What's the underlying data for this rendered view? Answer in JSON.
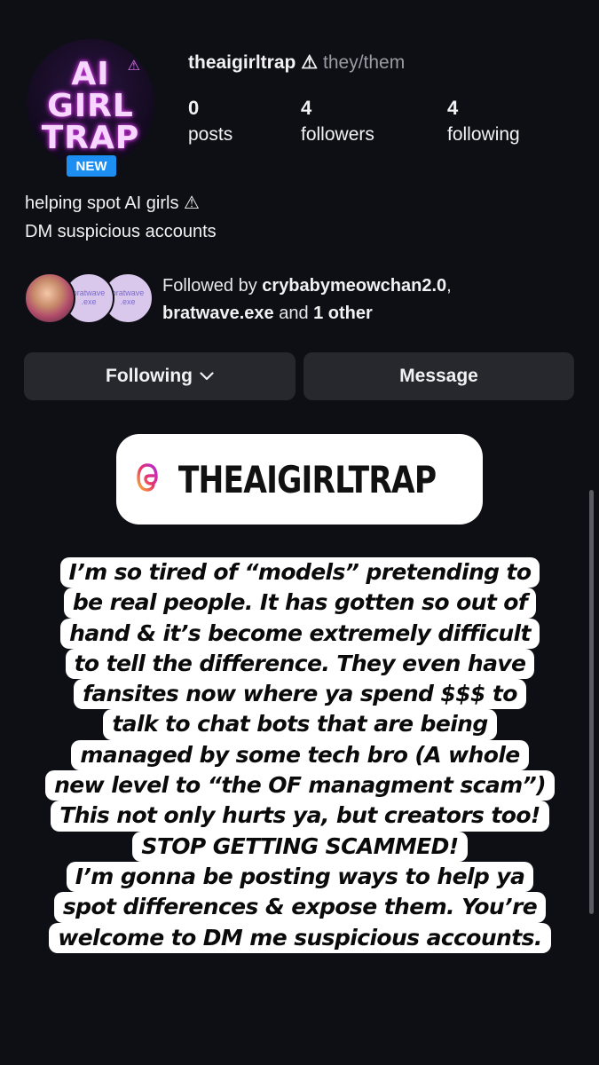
{
  "profile": {
    "avatar_text": [
      "AI",
      "GIRL",
      "TRAP"
    ],
    "badge": "NEW",
    "username": "theaigirltrap ⚠",
    "pronouns": "they/them",
    "stats": [
      {
        "value": "0",
        "label": "posts"
      },
      {
        "value": "4",
        "label": "followers"
      },
      {
        "value": "4",
        "label": "following"
      }
    ],
    "bio": [
      "helping spot AI girls ⚠",
      "DM suspicious accounts"
    ]
  },
  "followed_by": {
    "prefix": "Followed by ",
    "names": [
      "crybabymeowchan2.0",
      "bratwave.exe"
    ],
    "sep": ",",
    "and_text": " and ",
    "other": "1 other",
    "mini_avatar_text": "bratwave .exe"
  },
  "actions": {
    "following_label": "Following",
    "message_label": "Message"
  },
  "story": {
    "handle": "THEAIGIRLTRAP",
    "caption_lines": [
      "I’m so tired of “models” pretending to",
      "be real people. It has gotten so out of",
      "hand & it’s become extremely difficult",
      "to tell the difference. They even have",
      "fansites now where ya spend $$$ to",
      "talk to chat bots that are being",
      "managed by some tech bro (A whole",
      "new level to “the OF managment scam”)",
      "This not only hurts ya, but creators too!",
      "STOP GETTING SCAMMED!",
      "I’m gonna be posting ways to help ya",
      "spot differences & expose them. You’re",
      "welcome to DM me suspicious accounts."
    ]
  },
  "colors": {
    "background": "#0e0f14",
    "button_bg": "#26282e",
    "badge_blue": "#1d8ff2",
    "muted_text": "#9a9ba3"
  },
  "icons": [
    "warning-icon",
    "chevron-down-icon",
    "threads-icon"
  ]
}
